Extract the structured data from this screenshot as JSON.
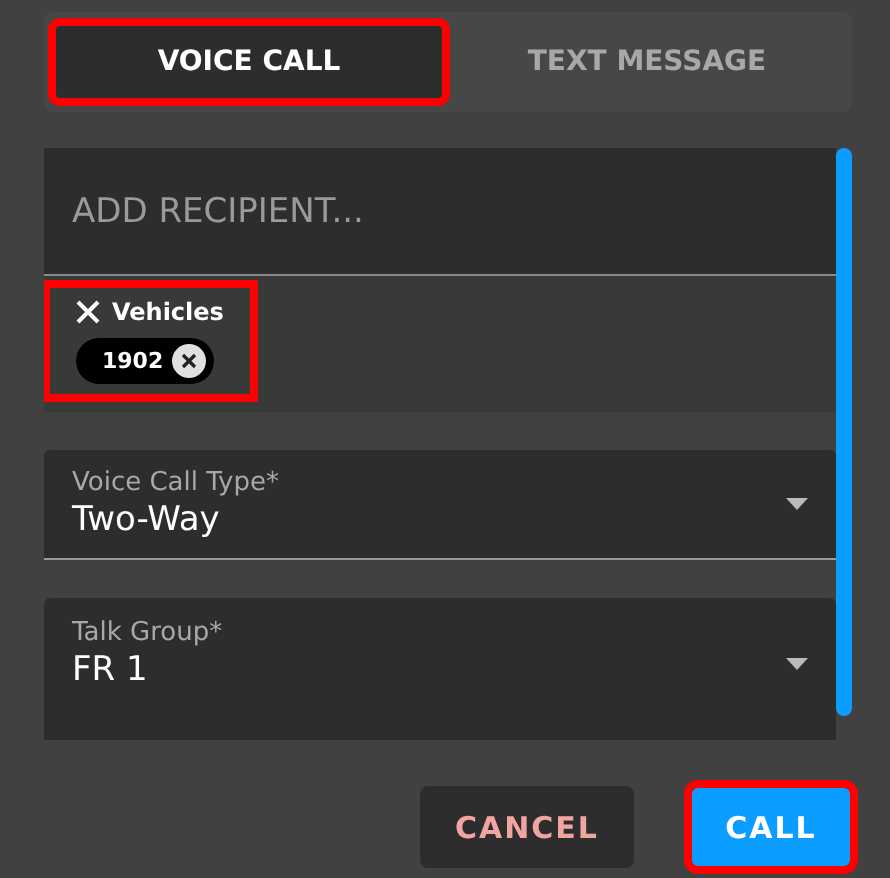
{
  "tabs": [
    {
      "label": "VOICE CALL",
      "selected": true,
      "highlighted": true
    },
    {
      "label": "TEXT MESSAGE",
      "selected": false,
      "highlighted": false
    }
  ],
  "recipient": {
    "placeholder": "ADD RECIPIENT..."
  },
  "recipient_groups": [
    {
      "name": "Vehicles",
      "highlighted": true,
      "chips": [
        "1902"
      ]
    }
  ],
  "fields": [
    {
      "label": "Voice Call Type*",
      "value": "Two-Way"
    },
    {
      "label": "Talk Group*",
      "value": "FR 1"
    }
  ],
  "buttons": [
    {
      "label": "CANCEL",
      "kind": "secondary",
      "highlighted": false
    },
    {
      "label": "CALL",
      "kind": "primary",
      "highlighted": true
    }
  ]
}
